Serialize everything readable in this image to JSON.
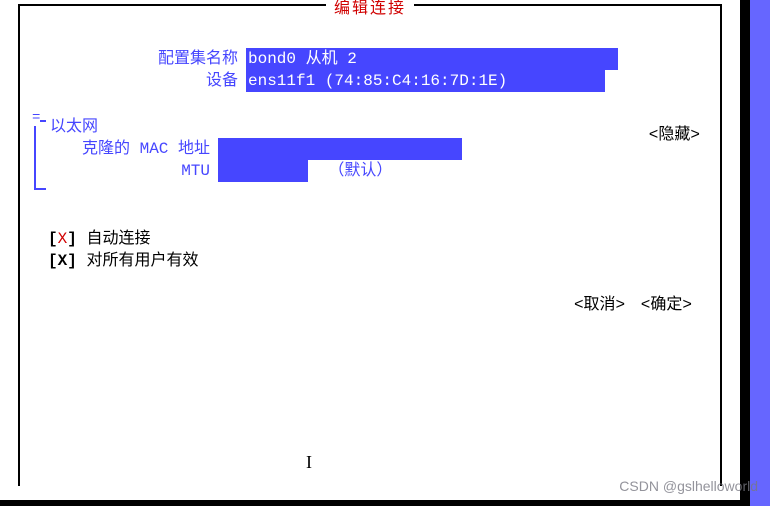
{
  "title": "编辑连接",
  "fields": {
    "profile_name_label": "配置集名称",
    "profile_name_value": "bond0 从机 2                           ",
    "device_label": "设备",
    "device_value": "ens11f1 (74:85:C4:16:7D:1E)          "
  },
  "ethernet": {
    "section_label": "以太网",
    "mac_label": "克隆的 MAC 地址",
    "mac_value": "                         ",
    "mtu_label": "MTU",
    "mtu_value": "         ",
    "mtu_hint": "（默认）",
    "hide_label": "<隐藏>"
  },
  "checkboxes": {
    "auto_mark": "X",
    "auto_label": "自动连接",
    "allusers_mark": "X",
    "allusers_label": "对所有用户有效"
  },
  "buttons": {
    "cancel": "<取消>",
    "ok": "<确定>"
  },
  "watermark": "CSDN @gslhelloworld"
}
